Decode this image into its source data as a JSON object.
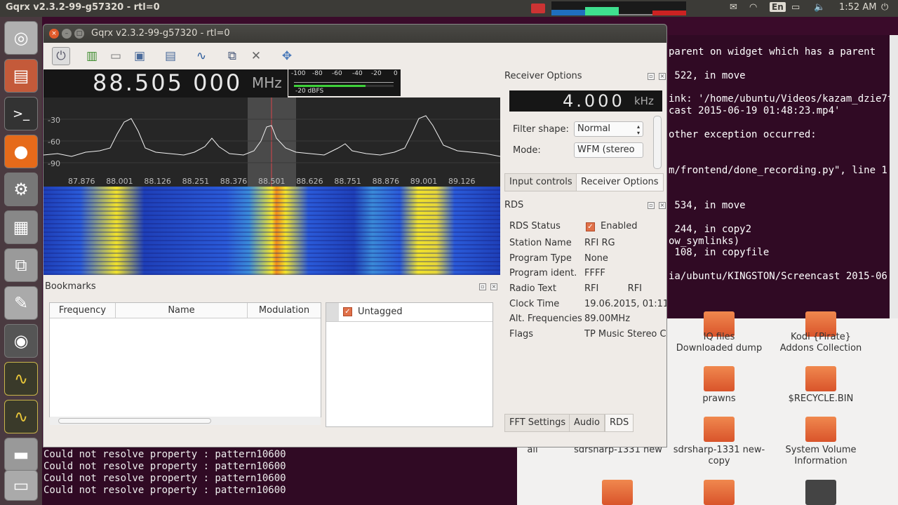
{
  "topbar": {
    "title": "Gqrx v2.3.2-99-g57320 - rtl=0",
    "lang": "En",
    "time": "1:52 AM",
    "icons": [
      "record-icon",
      "cpu-graph-icon",
      "memory-graph-icon",
      "network-graph-icon",
      "disk-graph-icon",
      "mail-icon",
      "wifi-icon",
      "battery-icon",
      "speaker-icon",
      "power-icon"
    ]
  },
  "window": {
    "title": "Gqrx v2.3.2-99-g57320 - rtl=0",
    "toolbar_icons": [
      "power-icon",
      "device-icon",
      "open-icon",
      "save-icon",
      "bookmark-icon",
      "waveform-icon",
      "windows-icon",
      "tools-icon",
      "fullscreen-icon"
    ],
    "frequency": {
      "value": "88.505 000",
      "unit": "MHz"
    },
    "smeter": {
      "scale": [
        "-100",
        "-80",
        "-60",
        "-40",
        "-20",
        "0"
      ],
      "level_label": "-20 dBFS",
      "level_fraction": 0.72
    },
    "fft": {
      "y_labels": [
        "-30",
        "-60",
        "-90"
      ],
      "x_labels": [
        "87.876",
        "88.001",
        "88.126",
        "88.251",
        "88.376",
        "88.501",
        "88.626",
        "88.751",
        "88.876",
        "89.001",
        "89.126"
      ]
    },
    "bookmarks": {
      "title": "Bookmarks",
      "columns": [
        "Frequency",
        "Name",
        "Modulation"
      ],
      "tags": [
        {
          "label": "Untagged",
          "checked": true
        }
      ]
    },
    "receiver": {
      "title": "Receiver Options",
      "offset": "4.000",
      "offset_unit": "kHz",
      "filter_shape_label": "Filter shape:",
      "filter_shape_value": "Normal",
      "mode_label": "Mode:",
      "mode_value": "WFM (stereo",
      "tabs": [
        "Input controls",
        "Receiver Options"
      ],
      "active_tab": 1
    },
    "rds": {
      "title": "RDS",
      "rows": [
        {
          "key": "RDS Status",
          "value": "Enabled",
          "checkbox": true
        },
        {
          "key": "Station Name",
          "value": "RFI RG"
        },
        {
          "key": "Program Type",
          "value": "None"
        },
        {
          "key": "Program ident.",
          "value": "FFFF"
        },
        {
          "key": "Radio Text",
          "value": "RFI          RFI"
        },
        {
          "key": "Clock Time",
          "value": "19.06.2015, 01:11"
        },
        {
          "key": "Alt. Frequencies",
          "value": "89.00MHz"
        },
        {
          "key": "Flags",
          "value": "TP Music Stereo C"
        }
      ],
      "tabs": [
        "FFT Settings",
        "Audio",
        "RDS"
      ],
      "active_tab": 2
    }
  },
  "terminal": {
    "lines": [
      "parent on widget which has a parent",
      "",
      " 522, in move",
      "",
      "ink: '/home/ubuntu/Videos/kazam_dzie7t",
      "cast 2015-06-19 01:48:23.mp4'",
      "",
      "other exception occurred:",
      "",
      "",
      "m/frontend/done_recording.py\", line 1",
      "",
      "",
      " 534, in move",
      "",
      " 244, in copy2",
      "ow_symlinks)",
      " 108, in copyfile",
      "",
      "ia/ubuntu/KINGSTON/Screencast 2015-06"
    ]
  },
  "desktop": {
    "items": [
      {
        "label": "IQ files\nDownloaded dump"
      },
      {
        "label": "Kodi {Pirate}\nAddons Collection"
      },
      {
        "label": "prawns"
      },
      {
        "label": "$RECYCLE.BIN"
      },
      {
        "label": "sdrsharp-1331 new"
      },
      {
        "label": "sdrsharp-1331 new-\ncopy"
      },
      {
        "label": "System Volume\nInformation"
      },
      {
        "label": "all"
      }
    ]
  },
  "bottom_terminal": {
    "lines": [
      "Could not resolve property : pattern10600",
      "Could not resolve property : pattern10600",
      "Could not resolve property : pattern10600",
      "Could not resolve property : pattern10600"
    ]
  },
  "launcher": {
    "items": [
      "ubuntu-logo-icon",
      "files-icon",
      "terminal-icon",
      "firefox-icon",
      "settings-icon",
      "calculator-icon",
      "network-icon",
      "text-editor-icon",
      "disk-icon",
      "gqrx-icon",
      "gqrx-icon-2",
      "drive-icon",
      "printer-icon"
    ]
  }
}
